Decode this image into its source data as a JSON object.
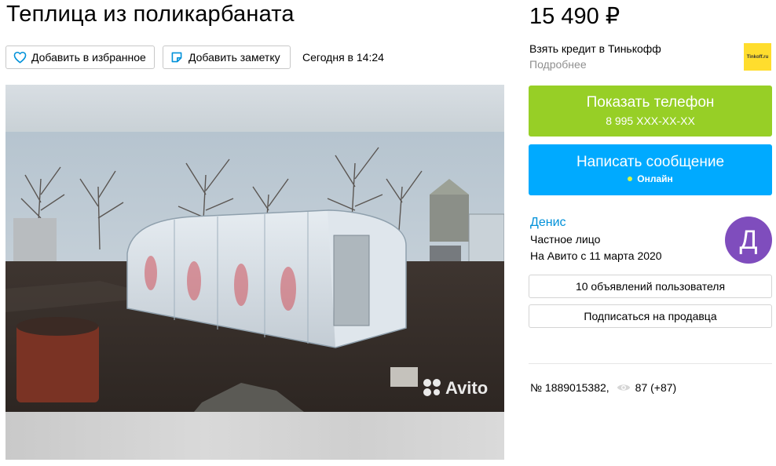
{
  "listing": {
    "title": "Теплица из поликарбаната",
    "price": "15 490 ₽",
    "favorite_label": "Добавить в избранное",
    "note_label": "Добавить заметку",
    "posted": "Сегодня в 14:24",
    "watermark": "Avito",
    "id_text": "№ 1889015382,",
    "views": "87 (+87)"
  },
  "credit": {
    "text": "Взять кредит в Тинькофф",
    "more": "Подробнее",
    "logo_text": "Tinkoff.ru"
  },
  "contact": {
    "show_phone": "Показать телефон",
    "phone_mask": "8 995 XXX-XX-XX",
    "write_message": "Написать сообщение",
    "online": "Онлайн"
  },
  "seller": {
    "name": "Денис",
    "type": "Частное лицо",
    "since": "На Авито с 11 марта 2020",
    "avatar_letter": "Д",
    "ads_button": "10 объявлений пользователя",
    "subscribe_button": "Подписаться на продавца"
  },
  "colors": {
    "green": "#97cf26",
    "blue": "#00aaff",
    "link": "#0091d9",
    "avatar": "#7f4dbd",
    "tinkoff": "#ffdd2d"
  },
  "icons": [
    "heart-icon",
    "note-icon",
    "eye-icon",
    "camera-icon"
  ]
}
